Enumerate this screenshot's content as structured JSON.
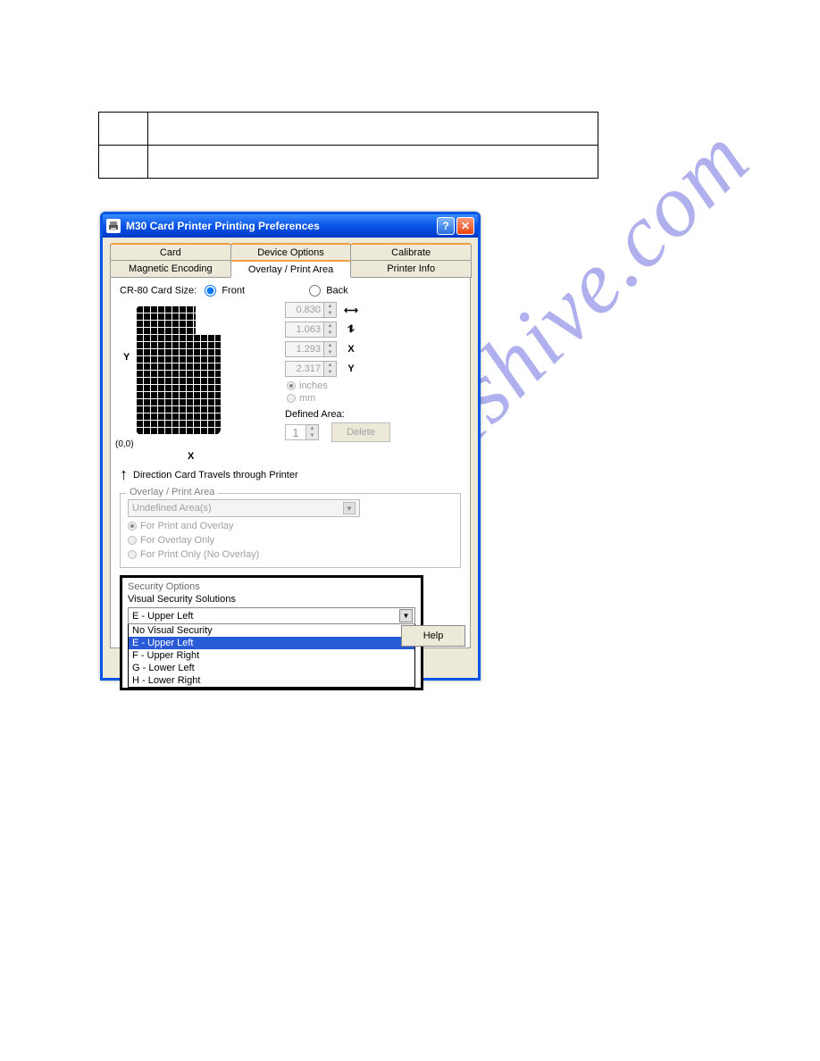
{
  "watermark": "manualshive.com",
  "dialog": {
    "title": "M30 Card Printer Printing Preferences",
    "tabs_row1": [
      "Card",
      "Device Options",
      "Calibrate"
    ],
    "tabs_row2": [
      "Magnetic Encoding",
      "Overlay / Print Area",
      "Printer Info"
    ],
    "active_tab": "Overlay / Print Area",
    "card_size_label": "CR-80 Card Size:",
    "front_label": "Front",
    "back_label": "Back",
    "dims": {
      "w": "0.830",
      "h": "1.063",
      "x": "1.293",
      "y": "2.317"
    },
    "dim_icons": {
      "w": "↔",
      "h": "↕",
      "x": "X",
      "y": "Y"
    },
    "units": {
      "inches": "inches",
      "mm": "mm"
    },
    "defined_area_label": "Defined Area:",
    "defined_area_value": "1",
    "delete_label": "Delete",
    "direction_label": "Direction Card Travels through Printer",
    "axis": {
      "y": "Y",
      "x": "X",
      "origin": "(0,0)"
    },
    "overlay_group": {
      "legend": "Overlay / Print Area",
      "select": "Undefined Area(s)",
      "radios": [
        "For Print and Overlay",
        "For Overlay Only",
        "For Print Only (No Overlay)"
      ]
    },
    "security": {
      "legend": "Security Options",
      "label": "Visual Security Solutions",
      "selected": "E - Upper Left",
      "options": [
        "No Visual Security",
        "E - Upper Left",
        "F - Upper Right",
        "G - Lower Left",
        "H - Lower Right"
      ]
    },
    "help_label": "Help"
  }
}
